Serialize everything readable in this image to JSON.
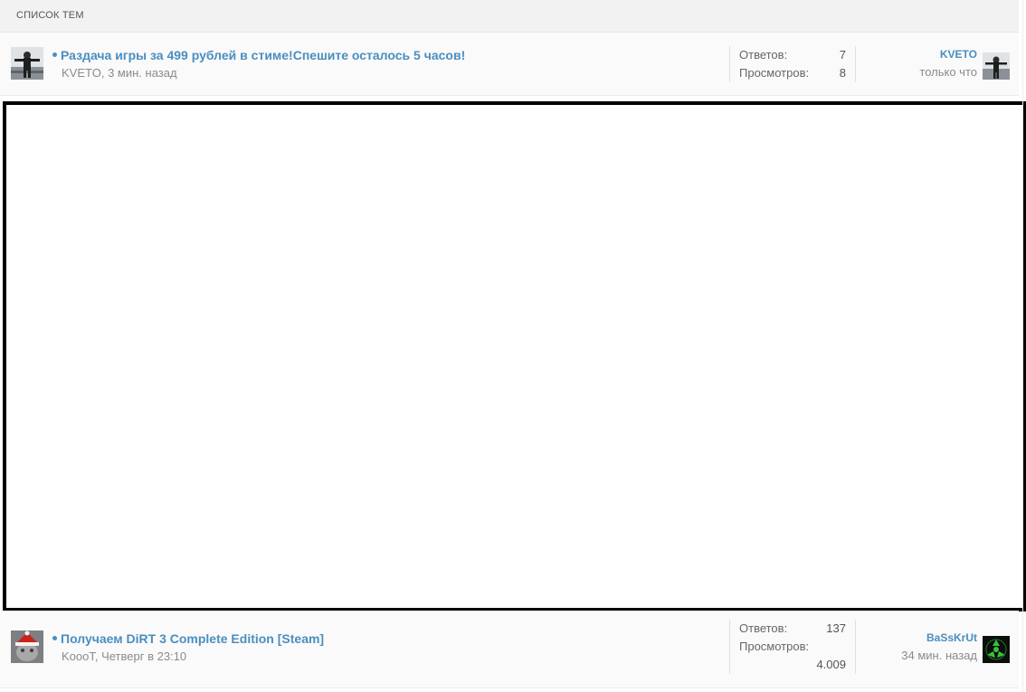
{
  "header": {
    "title": "СПИСОК ТЕМ"
  },
  "topics": [
    {
      "title": "Раздача игры за 499 рублей в стиме!Спешите осталось 5 часов!",
      "author": "KVETO",
      "time": ", 3 мин. назад",
      "replies_label": "Ответов:",
      "replies": "7",
      "views_label": "Просмотров:",
      "views": "8",
      "last_user": "KVETO",
      "last_time": "только что"
    },
    {
      "title": "Получаем DiRT 3 Complete Edition [Steam]",
      "author": "KoooT",
      "time": ", Четверг в 23:10",
      "replies_label": "Ответов:",
      "replies": "137",
      "views_label": "Просмотров:",
      "views": "4.009",
      "last_user": "BaSsKrUt",
      "last_time": "34 мин. назад"
    }
  ],
  "colors": {
    "link": "#4a8ec0",
    "header_bg": "#f2f2f2",
    "row_bg": "#fafafa"
  }
}
